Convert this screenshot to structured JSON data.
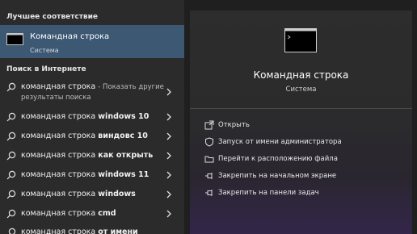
{
  "left": {
    "best_match_title": "Лучшее соответствие",
    "best_match": {
      "title": "Командная строка",
      "subtitle": "Система",
      "icon": "cmd-icon"
    },
    "web_title": "Поиск в Интернете",
    "web_results": [
      {
        "prefix": "командная строка",
        "bold": "",
        "muted": "- Показать другие",
        "cont": "результаты поиска"
      },
      {
        "prefix": "командная строка",
        "bold": "windows 10"
      },
      {
        "prefix": "командная строка",
        "bold": "виндовс 10"
      },
      {
        "prefix": "командная строка",
        "bold": "как открыть"
      },
      {
        "prefix": "командная строка",
        "bold": "windows 11"
      },
      {
        "prefix": "командная строка",
        "bold": "windows"
      },
      {
        "prefix": "командная строка",
        "bold": "cmd"
      },
      {
        "prefix": "командная строка",
        "bold": "от имени"
      }
    ]
  },
  "right": {
    "title": "Командная строка",
    "subtitle": "Система",
    "actions": [
      {
        "label": "Открыть",
        "icon": "open-icon"
      },
      {
        "label": "Запуск от имени администратора",
        "icon": "shield-icon"
      },
      {
        "label": "Перейти к расположению файла",
        "icon": "folder-icon"
      },
      {
        "label": "Закрепить на начальном экране",
        "icon": "pin-icon"
      },
      {
        "label": "Закрепить на панели задач",
        "icon": "pin-icon"
      }
    ]
  }
}
